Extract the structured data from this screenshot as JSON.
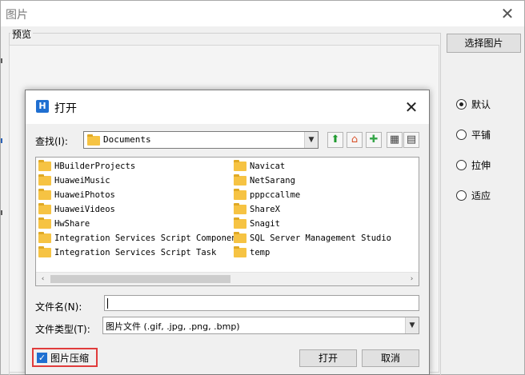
{
  "outer": {
    "title": "图片",
    "close_glyph": "✕",
    "preview_label": "预览",
    "select_image_button": "选择图片",
    "radio_options": [
      {
        "label": "默认",
        "checked": true
      },
      {
        "label": "平铺",
        "checked": false
      },
      {
        "label": "拉伸",
        "checked": false
      },
      {
        "label": "适应",
        "checked": false
      }
    ]
  },
  "open_dialog": {
    "title": "打开",
    "close_glyph": "✕",
    "look_in_label": "查找(I):",
    "look_in_value": "Documents",
    "toolbar": [
      {
        "icon": "up-folder-icon",
        "glyph": "⬆",
        "color": "#1f9a2f"
      },
      {
        "icon": "home-icon",
        "glyph": "⌂",
        "color": "#d9532c"
      },
      {
        "icon": "new-folder-icon",
        "glyph": "✚",
        "color": "#37a64a"
      },
      {
        "icon": "list-view-icon",
        "glyph": "▦",
        "color": "#444444"
      },
      {
        "icon": "details-view-icon",
        "glyph": "▤",
        "color": "#444444"
      }
    ],
    "files_col1": [
      "HBuilderProjects",
      "HuaweiMusic",
      "HuaweiPhotos",
      "HuaweiVideos",
      "HwShare",
      "Integration Services Script Component",
      "Integration Services Script Task"
    ],
    "files_col2": [
      "Navicat",
      "NetSarang",
      "pppccallme",
      "ShareX",
      "Snagit",
      "SQL Server Management Studio",
      "temp"
    ],
    "scroll_left_glyph": "‹",
    "scroll_right_glyph": "›",
    "file_name_label": "文件名(N):",
    "file_name_value": "",
    "file_type_label": "文件类型(T):",
    "file_type_value": "图片文件 (.gif, .jpg, .png, .bmp)",
    "combo_arrow_glyph": "▼",
    "compress_label": "图片压缩",
    "compress_checked": true,
    "checkmark_glyph": "✓",
    "open_button": "打开",
    "cancel_button": "取消",
    "logo_glyph": "H"
  },
  "colors": {
    "accent": "#1f6fd1",
    "highlight_border": "#e03c3c",
    "folder": "#f6c343"
  }
}
